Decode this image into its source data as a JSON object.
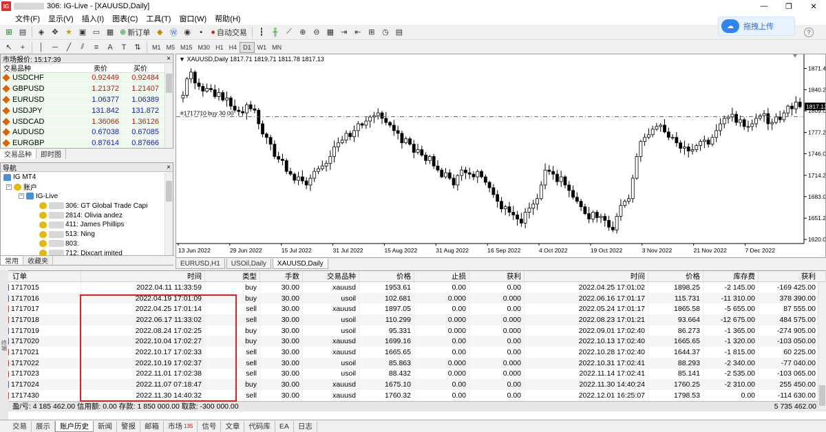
{
  "window": {
    "logo": "IG",
    "title_prefix": "",
    "title": "306: IG-Live - [XAUUSD,Daily]",
    "controls": [
      "—",
      "❐",
      "✕"
    ]
  },
  "menu": [
    "文件(F)",
    "显示(V)",
    "插入(I)",
    "图表(C)",
    "工具(T)",
    "窗口(W)",
    "帮助(H)"
  ],
  "toolbar": {
    "new_order": "新订单",
    "auto_trade": "自动交易",
    "upload_label": "拖拽上传",
    "timeframes": [
      "M1",
      "M5",
      "M15",
      "M30",
      "H1",
      "H4",
      "D1",
      "W1",
      "MN"
    ],
    "active_timeframe": "D1",
    "draw_tools": [
      "A",
      "T"
    ]
  },
  "market_watch": {
    "title": "市场报价: 15:17:39",
    "col_symbol": "交易品种",
    "col_bid": "卖价",
    "col_ask": "买价",
    "rows": [
      {
        "symbol": "USDCHF",
        "bid": "0.92449",
        "ask": "0.92484",
        "dir": "dn"
      },
      {
        "symbol": "GBPUSD",
        "bid": "1.21372",
        "ask": "1.21407",
        "dir": "dn"
      },
      {
        "symbol": "EURUSD",
        "bid": "1.06377",
        "ask": "1.06389",
        "dir": "up"
      },
      {
        "symbol": "USDJPY",
        "bid": "131.842",
        "ask": "131.872",
        "dir": "up"
      },
      {
        "symbol": "USDCAD",
        "bid": "1.36066",
        "ask": "1.36126",
        "dir": "dn"
      },
      {
        "symbol": "AUDUSD",
        "bid": "0.67038",
        "ask": "0.67085",
        "dir": "up"
      },
      {
        "symbol": "EURGBP",
        "bid": "0.87614",
        "ask": "0.87666",
        "dir": "up"
      }
    ],
    "tabs": [
      "交易品种",
      "即时图"
    ]
  },
  "navigator": {
    "title": "导航",
    "root": "IG MT4",
    "accounts_label": "账户",
    "server": "IG-Live",
    "accounts": [
      "306: GT Global Trade Capi",
      "2814: Olivia andez",
      "411: James Phillips",
      "513: Ning",
      "803:",
      "712: Dixcart imited"
    ],
    "tabs": [
      "常用",
      "收藏夹"
    ]
  },
  "chart": {
    "info": "XAUUSD,Daily  1817.71 1819.71 1811.78 1817.13",
    "order_line_label": "#1717710 buy 30.00",
    "current_price_label": "1817.13",
    "tabs": [
      "EURUSD,H1",
      "USOil,Daily",
      "XAUUSD,Daily"
    ],
    "active_tab": "XAUUSD,Daily"
  },
  "chart_data": {
    "type": "candlestick",
    "symbol": "XAUUSD",
    "timeframe": "Daily",
    "y_ticks": [
      1871.4,
      1840.2,
      1809.0,
      1777.2,
      1746.0,
      1714.2,
      1683.0,
      1651.2,
      1620.0
    ],
    "ylim": [
      1614,
      1884
    ],
    "x_ticks": [
      "13 Jun 2022",
      "29 Jun 2022",
      "15 Jul 2022",
      "31 Jul 2022",
      "15 Aug 2022",
      "31 Aug 2022",
      "16 Sep 2022",
      "4 Oct 2022",
      "19 Oct 2022",
      "3 Nov 2022",
      "21 Nov 2022",
      "7 Dec 2022"
    ],
    "order_line_price": 1800.5,
    "closes": [
      1832,
      1856,
      1866,
      1850,
      1845,
      1838,
      1842,
      1840,
      1830,
      1836,
      1825,
      1828,
      1816,
      1810,
      1808,
      1806,
      1818,
      1812,
      1810,
      1790,
      1775,
      1770,
      1760,
      1742,
      1738,
      1736,
      1720,
      1716,
      1707,
      1712,
      1706,
      1700,
      1710,
      1720,
      1724,
      1728,
      1732,
      1742,
      1756,
      1762,
      1766,
      1776,
      1771,
      1780,
      1790,
      1788,
      1794,
      1800,
      1802,
      1806,
      1798,
      1792,
      1788,
      1780,
      1776,
      1762,
      1768,
      1760,
      1748,
      1752,
      1744,
      1736,
      1742,
      1728,
      1722,
      1712,
      1718,
      1710,
      1700,
      1714,
      1722,
      1718,
      1716,
      1712,
      1720,
      1712,
      1704,
      1696,
      1686,
      1676,
      1665,
      1668,
      1660,
      1656,
      1650,
      1644,
      1660,
      1666,
      1672,
      1680,
      1700,
      1722,
      1720,
      1716,
      1705,
      1712,
      1700,
      1692,
      1682,
      1676,
      1668,
      1658,
      1650,
      1660,
      1652,
      1654,
      1648,
      1638,
      1634,
      1654,
      1670,
      1676,
      1680,
      1710,
      1742,
      1764,
      1770,
      1774,
      1782,
      1786,
      1788,
      1778,
      1770,
      1770,
      1762,
      1754,
      1756,
      1750,
      1752,
      1758,
      1764,
      1766,
      1760,
      1770,
      1780,
      1790,
      1798,
      1800,
      1804,
      1792,
      1796,
      1786,
      1786,
      1790,
      1798,
      1802,
      1805,
      1790,
      1792,
      1800,
      1796,
      1806,
      1816,
      1812,
      1822,
      1815
    ]
  },
  "history": {
    "headers": {
      "order": "订单",
      "time": "时间",
      "type": "类型",
      "volume": "手数",
      "symbol": "交易品种",
      "price": "价格",
      "sl": "止损",
      "tp": "获利",
      "close_time": "时间",
      "close_price": "价格",
      "swap": "库存费",
      "profit": "获利"
    },
    "rows": [
      {
        "order": "1717015",
        "time": "2022.04.11 11:33:59",
        "type": "buy",
        "volume": "30.00",
        "symbol": "xauusd",
        "price": "1953.61",
        "sl": "0.00",
        "tp": "0.00",
        "close_time": "2022.04.25 17:01:02",
        "close_price": "1898.25",
        "swap": "-2 145.00",
        "profit": "-169 425.00"
      },
      {
        "order": "1717016",
        "time": "2022.04.19 17:01:09",
        "type": "buy",
        "volume": "30.00",
        "symbol": "usoil",
        "price": "102.681",
        "sl": "0.000",
        "tp": "0.000",
        "close_time": "2022.06.16 17:01:17",
        "close_price": "115.731",
        "swap": "-11 310.00",
        "profit": "378 390.00"
      },
      {
        "order": "1717017",
        "time": "2022.04.25 17:01:14",
        "type": "sell",
        "volume": "30.00",
        "symbol": "xauusd",
        "price": "1897.05",
        "sl": "0.00",
        "tp": "0.00",
        "close_time": "2022.05.24 17:01:17",
        "close_price": "1865.58",
        "swap": "-5 655.00",
        "profit": "87 555.00"
      },
      {
        "order": "1717018",
        "time": "2022.06.17 11:33:02",
        "type": "sell",
        "volume": "30.00",
        "symbol": "usoil",
        "price": "110.299",
        "sl": "0.000",
        "tp": "0.000",
        "close_time": "2022.08.23 17:01:21",
        "close_price": "93.664",
        "swap": "-12 675.00",
        "profit": "484 575.00"
      },
      {
        "order": "1717019",
        "time": "2022.08.24 17:02:25",
        "type": "buy",
        "volume": "30.00",
        "symbol": "usoil",
        "price": "95.331",
        "sl": "0.000",
        "tp": "0.000",
        "close_time": "2022.09.01 17:02:40",
        "close_price": "86.273",
        "swap": "-1 365.00",
        "profit": "-274 905.00"
      },
      {
        "order": "1717020",
        "time": "2022.10.04 17:02:27",
        "type": "buy",
        "volume": "30.00",
        "symbol": "xauusd",
        "price": "1699.16",
        "sl": "0.00",
        "tp": "0.00",
        "close_time": "2022.10.13 17:02:40",
        "close_price": "1665.65",
        "swap": "-1 320.00",
        "profit": "-103 050.00"
      },
      {
        "order": "1717021",
        "time": "2022.10.17 17:02:33",
        "type": "sell",
        "volume": "30.00",
        "symbol": "xauusd",
        "price": "1665.65",
        "sl": "0.00",
        "tp": "0.00",
        "close_time": "2022.10.28 17:02:40",
        "close_price": "1644.37",
        "swap": "-1 815.00",
        "profit": "60 225.00"
      },
      {
        "order": "1717022",
        "time": "2022.10.19 17:02:37",
        "type": "sell",
        "volume": "30.00",
        "symbol": "usoil",
        "price": "85.863",
        "sl": "0.000",
        "tp": "0.000",
        "close_time": "2022.10.31 17:02:41",
        "close_price": "88.293",
        "swap": "-2 340.00",
        "profit": "-77 040.00"
      },
      {
        "order": "1717023",
        "time": "2022.11.01 17:02:38",
        "type": "sell",
        "volume": "30.00",
        "symbol": "usoil",
        "price": "88.432",
        "sl": "0.000",
        "tp": "0.000",
        "close_time": "2022.11.14 17:02:41",
        "close_price": "85.141",
        "swap": "-2 535.00",
        "profit": "-103 065.00"
      },
      {
        "order": "1717024",
        "time": "2022.11.07 07:18:47",
        "type": "buy",
        "volume": "30.00",
        "symbol": "xauusd",
        "price": "1675.10",
        "sl": "0.00",
        "tp": "0.00",
        "close_time": "2022.11.30 14:40:24",
        "close_price": "1760.25",
        "swap": "-2 310.00",
        "profit": "255 450.00"
      },
      {
        "order": "1717430",
        "time": "2022.11.30 14:40:32",
        "type": "sell",
        "volume": "30.00",
        "symbol": "xauusd",
        "price": "1760.32",
        "sl": "0.00",
        "tp": "0.00",
        "close_time": "2022.12.01 16:25:07",
        "close_price": "1798.53",
        "swap": "0.00",
        "profit": "-114 630.00"
      }
    ],
    "total_text": "盈/亏: 4 185 462.00  信用额: 0.00  存款: 1 850 000.00  取款: -300 000.00",
    "total_value": "5 735 462.00"
  },
  "terminal_tabs": [
    {
      "label": "交易"
    },
    {
      "label": "展示"
    },
    {
      "label": "账户历史"
    },
    {
      "label": "新闻"
    },
    {
      "label": "警报"
    },
    {
      "label": "邮箱"
    },
    {
      "label": "市场",
      "badge": "135"
    },
    {
      "label": "信号"
    },
    {
      "label": "文章"
    },
    {
      "label": "代码库"
    },
    {
      "label": "EA"
    },
    {
      "label": "日志"
    }
  ],
  "active_terminal_tab": "账户历史",
  "terminal_side_label": "终端"
}
